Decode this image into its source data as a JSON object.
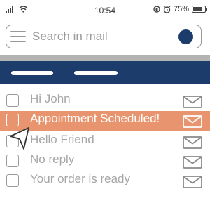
{
  "status_bar": {
    "time": "10:54",
    "battery": "75%",
    "battery_level": 0.75
  },
  "search": {
    "placeholder": "Search in mail"
  },
  "emails": [
    {
      "subject": "Hi John",
      "selected": false
    },
    {
      "subject": "Appointment Scheduled!",
      "selected": true
    },
    {
      "subject": "Hello Friend",
      "selected": false
    },
    {
      "subject": "No reply",
      "selected": false
    },
    {
      "subject": "Your order is ready",
      "selected": false
    }
  ],
  "colors": {
    "nav": "#1c3c6b",
    "selected_row": "#e8956f",
    "muted_text": "#a6a6a6"
  },
  "icons": {
    "menu": "hamburger-icon",
    "avatar": "avatar-circle",
    "mail": "envelope-icon",
    "cursor": "pointer-arrow"
  }
}
